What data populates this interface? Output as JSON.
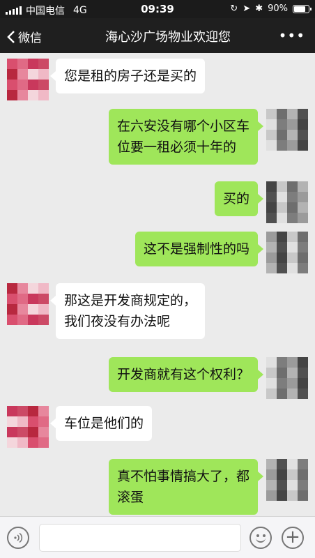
{
  "status_bar": {
    "carrier": "中国电信",
    "network": "4G",
    "time": "09:39",
    "battery": "90%",
    "battery_level": 0.9
  },
  "nav": {
    "back_label": "微信",
    "title": "海心沙广场物业欢迎您",
    "more_icon": "ellipsis-icon"
  },
  "messages": [
    {
      "side": "left",
      "lines": [
        "您是租的房子还是买的"
      ]
    },
    {
      "side": "right",
      "lines": [
        "在六安没有哪个小区车",
        "位要一租必须十年的"
      ]
    },
    {
      "side": "right",
      "lines": [
        "买的"
      ]
    },
    {
      "side": "right",
      "lines": [
        "这不是强制性的吗"
      ]
    },
    {
      "side": "left",
      "lines": [
        "那这是开发商规定的，",
        "我们夜没有办法呢"
      ]
    },
    {
      "side": "right",
      "lines": [
        "开发商就有这个权利？"
      ]
    },
    {
      "side": "left",
      "lines": [
        "车位是他们的"
      ]
    },
    {
      "side": "right",
      "lines": [
        "真不怕事情搞大了，都",
        "滚蛋"
      ]
    }
  ],
  "input_bar": {
    "voice_icon": "voice-icon",
    "emoji_icon": "emoji-icon",
    "plus_icon": "plus-icon",
    "input_value": ""
  },
  "colors": {
    "chat_background": "#ebebeb",
    "sent_bubble": "#9fe65a",
    "received_bubble": "#ffffff",
    "nav_background": "#1f1f1f"
  }
}
